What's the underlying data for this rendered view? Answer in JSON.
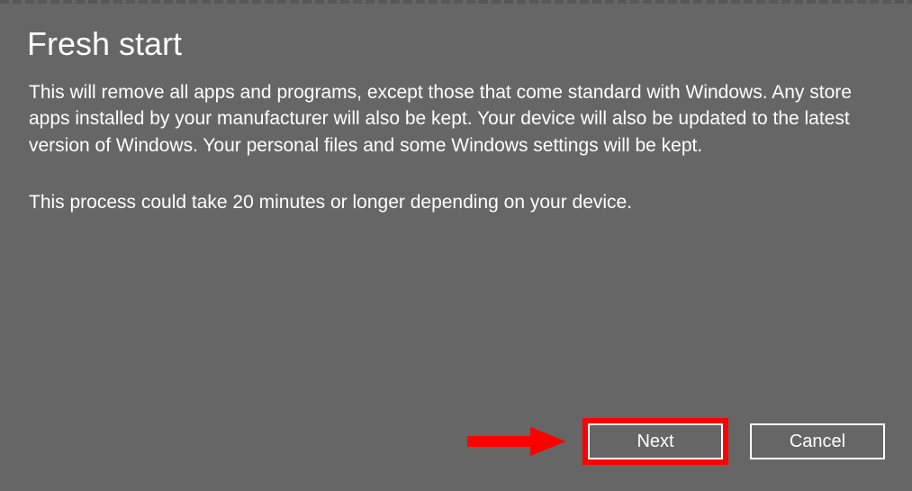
{
  "dialog": {
    "title": "Fresh start",
    "paragraph1": "This will remove all apps and programs, except those that come standard with Windows. Any store apps installed by your manufacturer will also be kept. Your device will also be updated to the latest version of Windows. Your personal files and some Windows settings will be kept.",
    "paragraph2": "This process could take 20 minutes or longer depending on your device."
  },
  "buttons": {
    "next_label": "Next",
    "cancel_label": "Cancel"
  },
  "annotation": {
    "arrow_color": "#ff0000",
    "highlight_color": "#ff0000"
  }
}
